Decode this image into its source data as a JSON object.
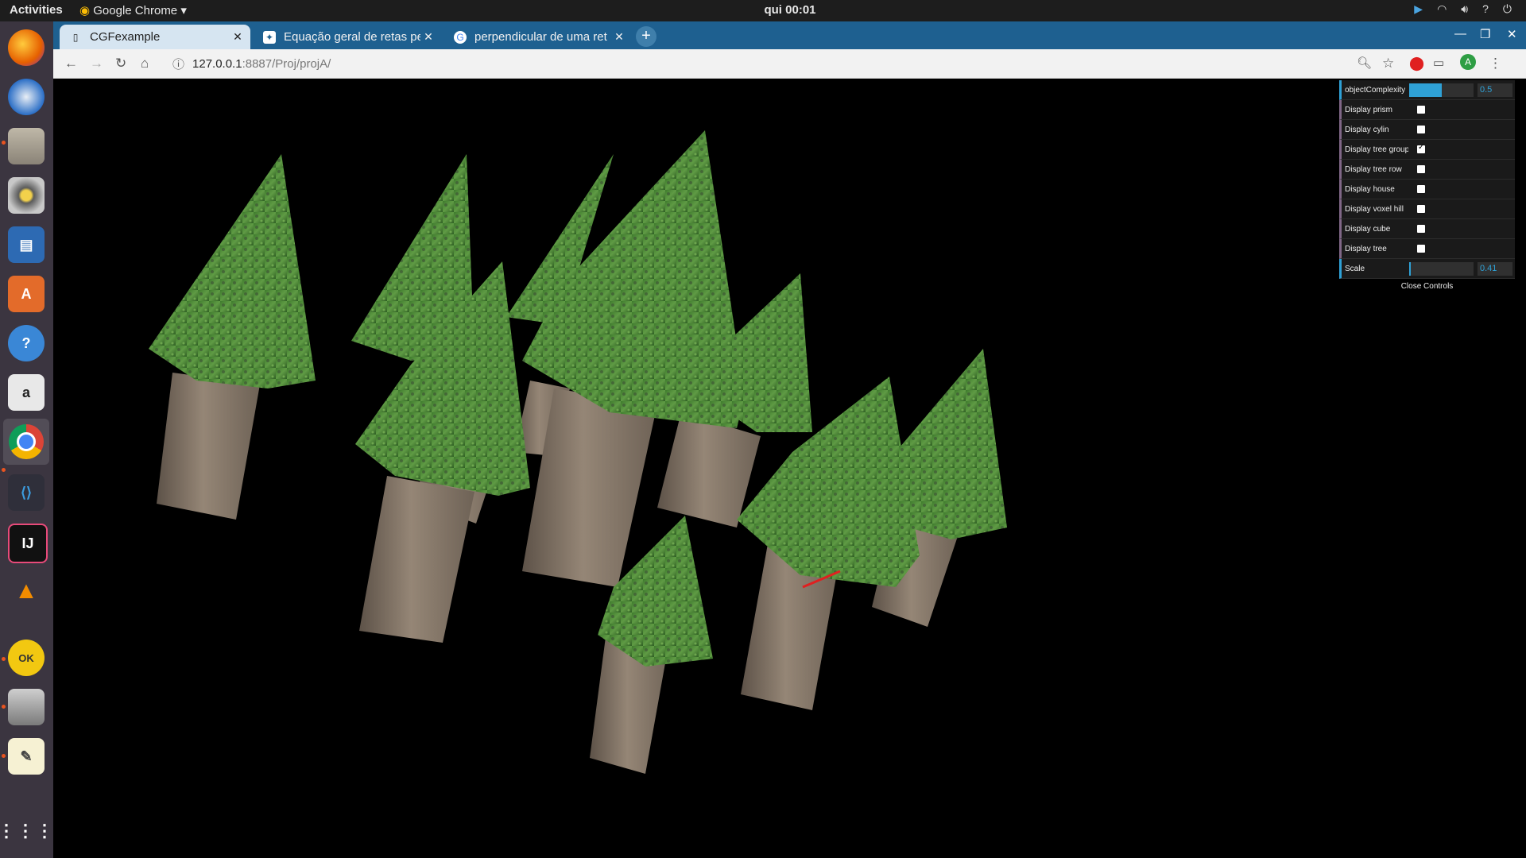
{
  "topbar": {
    "activities": "Activities",
    "app_name": "Google Chrome ▾",
    "clock": "qui 00:01"
  },
  "tabs": [
    {
      "title": "CGFexample",
      "active": true
    },
    {
      "title": "Equação geral de retas pe",
      "active": false
    },
    {
      "title": "perpendicular de uma ret",
      "active": false
    }
  ],
  "address": {
    "host": "127.0.0.1",
    "path": ":8887/Proj/projA/"
  },
  "gui": {
    "rows": [
      {
        "label": "objectComplexity",
        "type": "slider",
        "value": "0.5",
        "fill": 0.5
      },
      {
        "label": "Display prism",
        "type": "checkbox",
        "checked": false
      },
      {
        "label": "Display cylin",
        "type": "checkbox",
        "checked": false
      },
      {
        "label": "Display tree group",
        "type": "checkbox",
        "checked": true
      },
      {
        "label": "Display tree row",
        "type": "checkbox",
        "checked": false
      },
      {
        "label": "Display house",
        "type": "checkbox",
        "checked": false
      },
      {
        "label": "Display voxel hill",
        "type": "checkbox",
        "checked": false
      },
      {
        "label": "Display cube",
        "type": "checkbox",
        "checked": false
      },
      {
        "label": "Display tree",
        "type": "checkbox",
        "checked": false
      },
      {
        "label": "Scale",
        "type": "slider",
        "value": "0.41",
        "fill": 0.01
      }
    ],
    "close_label": "Close Controls"
  },
  "colors": {
    "tabstrip": "#1e6090",
    "foliage": "#4e8a3a",
    "trunk": "#7a6a5c",
    "gui_accent": "#2fa1d6"
  }
}
